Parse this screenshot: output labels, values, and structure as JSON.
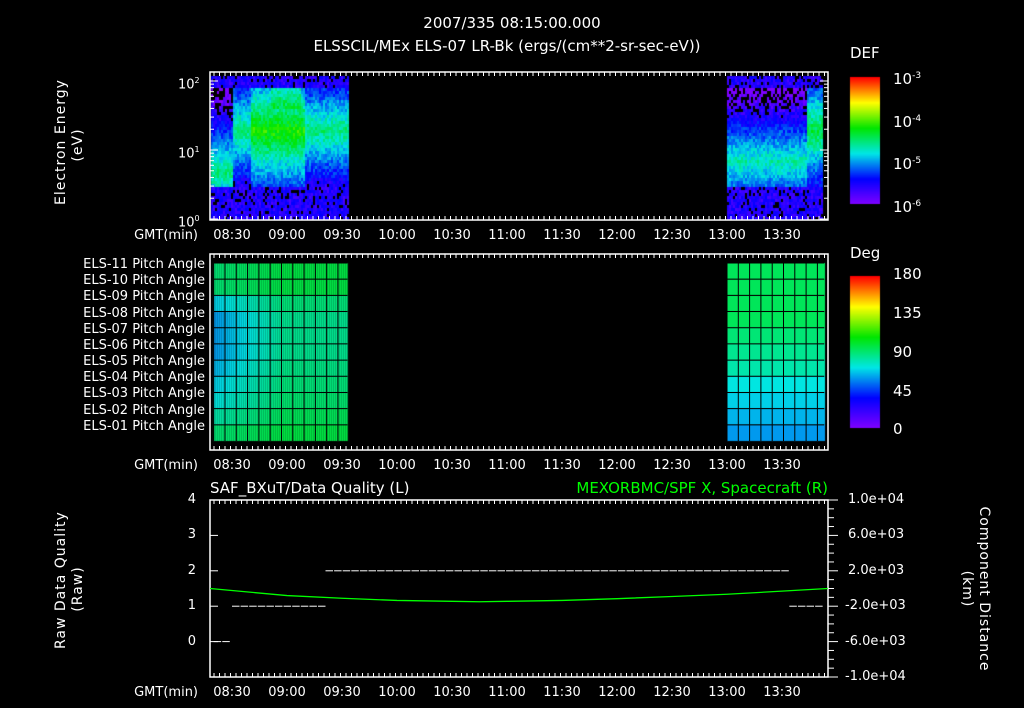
{
  "header": {
    "title": "2007/335 08:15:00.000",
    "subtitle": "ELSSCIL/MEx ELS-07 LR-Bk  (ergs/(cm**2-sr-sec-eV))"
  },
  "time_axis": {
    "label": "GMT(min)",
    "ticks": [
      "08:30",
      "09:00",
      "09:30",
      "10:00",
      "10:30",
      "11:00",
      "11:30",
      "12:00",
      "12:30",
      "13:00",
      "13:30"
    ]
  },
  "chart_data": [
    {
      "type": "heatmap",
      "title": "ELSSCIL/MEx ELS-07 LR-Bk",
      "ylabel": "Electron Energy",
      "yunit": "(eV)",
      "yscale": "log",
      "ylim": [
        1,
        200
      ],
      "ytick_labels": [
        {
          "base": "10",
          "exp": "0"
        },
        {
          "base": "10",
          "exp": "1"
        },
        {
          "base": "10",
          "exp": "2"
        }
      ],
      "data_intervals": [
        [
          "08:18",
          "09:33"
        ],
        [
          "13:00",
          "13:55"
        ]
      ],
      "colorbar": {
        "title": "DEF",
        "ticks": [
          {
            "base": "10",
            "exp": "-3"
          },
          {
            "base": "10",
            "exp": "-4"
          },
          {
            "base": "10",
            "exp": "-5"
          },
          {
            "base": "10",
            "exp": "-6"
          }
        ]
      }
    },
    {
      "type": "heatmap",
      "title": "Pitch angles",
      "rows": [
        "ELS-11 Pitch Angle",
        "ELS-10 Pitch Angle",
        "ELS-09 Pitch Angle",
        "ELS-08 Pitch Angle",
        "ELS-07 Pitch Angle",
        "ELS-06 Pitch Angle",
        "ELS-05 Pitch Angle",
        "ELS-04 Pitch Angle",
        "ELS-03 Pitch Angle",
        "ELS-02 Pitch Angle",
        "ELS-01 Pitch Angle"
      ],
      "data_intervals": [
        [
          "08:20",
          "09:33"
        ],
        [
          "13:00",
          "13:53"
        ]
      ],
      "approx_values_deg_first_interval": [
        95,
        95,
        70,
        60,
        60,
        60,
        65,
        70,
        75,
        85,
        95
      ],
      "approx_values_deg_second_interval": [
        100,
        100,
        100,
        100,
        95,
        90,
        85,
        75,
        70,
        65,
        60
      ],
      "colorbar": {
        "title": "Deg",
        "ticks": [
          "180",
          "135",
          "90",
          "45",
          "0"
        ],
        "range": [
          0,
          180
        ]
      }
    },
    {
      "type": "line",
      "left_title": "SAF_BXuT/Data Quality (L)",
      "right_title": "MEXORBMC/SPF X, Spacecraft (R)",
      "ylabel_left": "Raw Data Quality",
      "ylabel_left_unit": "(Raw)",
      "ylabel_right": "Component Distance",
      "ylabel_right_unit": "(km)",
      "ylim_left": [
        -1,
        4
      ],
      "left_ticks": [
        "4",
        "3",
        "2",
        "1",
        "0"
      ],
      "ylim_right": [
        -10000,
        10000
      ],
      "right_ticks": [
        "1.0e+04",
        "6.0e+03",
        "2.0e+03",
        "-2.0e+03",
        "-6.0e+03",
        "-1.0e+04"
      ],
      "series": [
        {
          "name": "Data Quality",
          "color": "#ffffff",
          "segments": [
            {
              "from": "08:20",
              "to": "08:30",
              "value": 0
            },
            {
              "from": "08:30",
              "to": "09:21",
              "value": 1
            },
            {
              "from": "09:21",
              "to": "13:34",
              "value": 2
            },
            {
              "from": "13:34",
              "to": "13:50",
              "value": 1
            }
          ]
        },
        {
          "name": "SPF X",
          "color": "#00ff00",
          "x": [
            "08:18",
            "09:00",
            "09:30",
            "10:00",
            "10:30",
            "10:45",
            "11:00",
            "11:30",
            "12:00",
            "12:30",
            "13:00",
            "13:30",
            "13:55"
          ],
          "y": [
            0,
            -800,
            -1100,
            -1350,
            -1450,
            -1500,
            -1450,
            -1350,
            -1150,
            -900,
            -650,
            -300,
            0
          ]
        }
      ]
    }
  ]
}
